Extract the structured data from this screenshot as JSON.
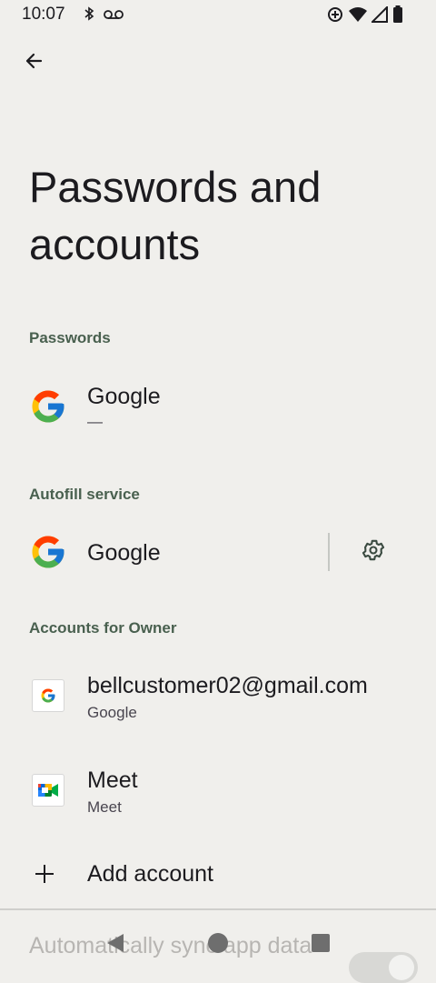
{
  "status": {
    "time": "10:07",
    "icons_left": [
      "bluetooth-icon",
      "voicemail-icon"
    ],
    "icons_right": [
      "data-saver-icon",
      "wifi-icon",
      "signal-icon",
      "battery-icon"
    ]
  },
  "header": {
    "back_icon": "arrow-back-icon",
    "title": "Passwords and accounts"
  },
  "passwords": {
    "section_label": "Passwords",
    "item": {
      "title": "Google",
      "subtitle": "—",
      "icon": "google-g-icon"
    }
  },
  "autofill": {
    "section_label": "Autofill service",
    "item": {
      "title": "Google",
      "icon": "google-g-icon",
      "settings_icon": "gear-icon"
    }
  },
  "accounts": {
    "section_label": "Accounts for Owner",
    "items": [
      {
        "title": "bellcustomer02@gmail.com",
        "subtitle": "Google",
        "icon": "google-account-icon"
      },
      {
        "title": "Meet",
        "subtitle": "Meet",
        "icon": "google-meet-icon"
      }
    ],
    "add_label": "Add account",
    "add_icon": "plus-icon"
  },
  "sync": {
    "label": "Automatically sync app data",
    "toggle_on": true
  },
  "nav": {
    "back": "nav-back-icon",
    "home": "nav-home-icon",
    "recents": "nav-recents-icon"
  },
  "colors": {
    "background": "#f0efec",
    "section_header": "#49604f",
    "text": "#1c1b1f"
  }
}
